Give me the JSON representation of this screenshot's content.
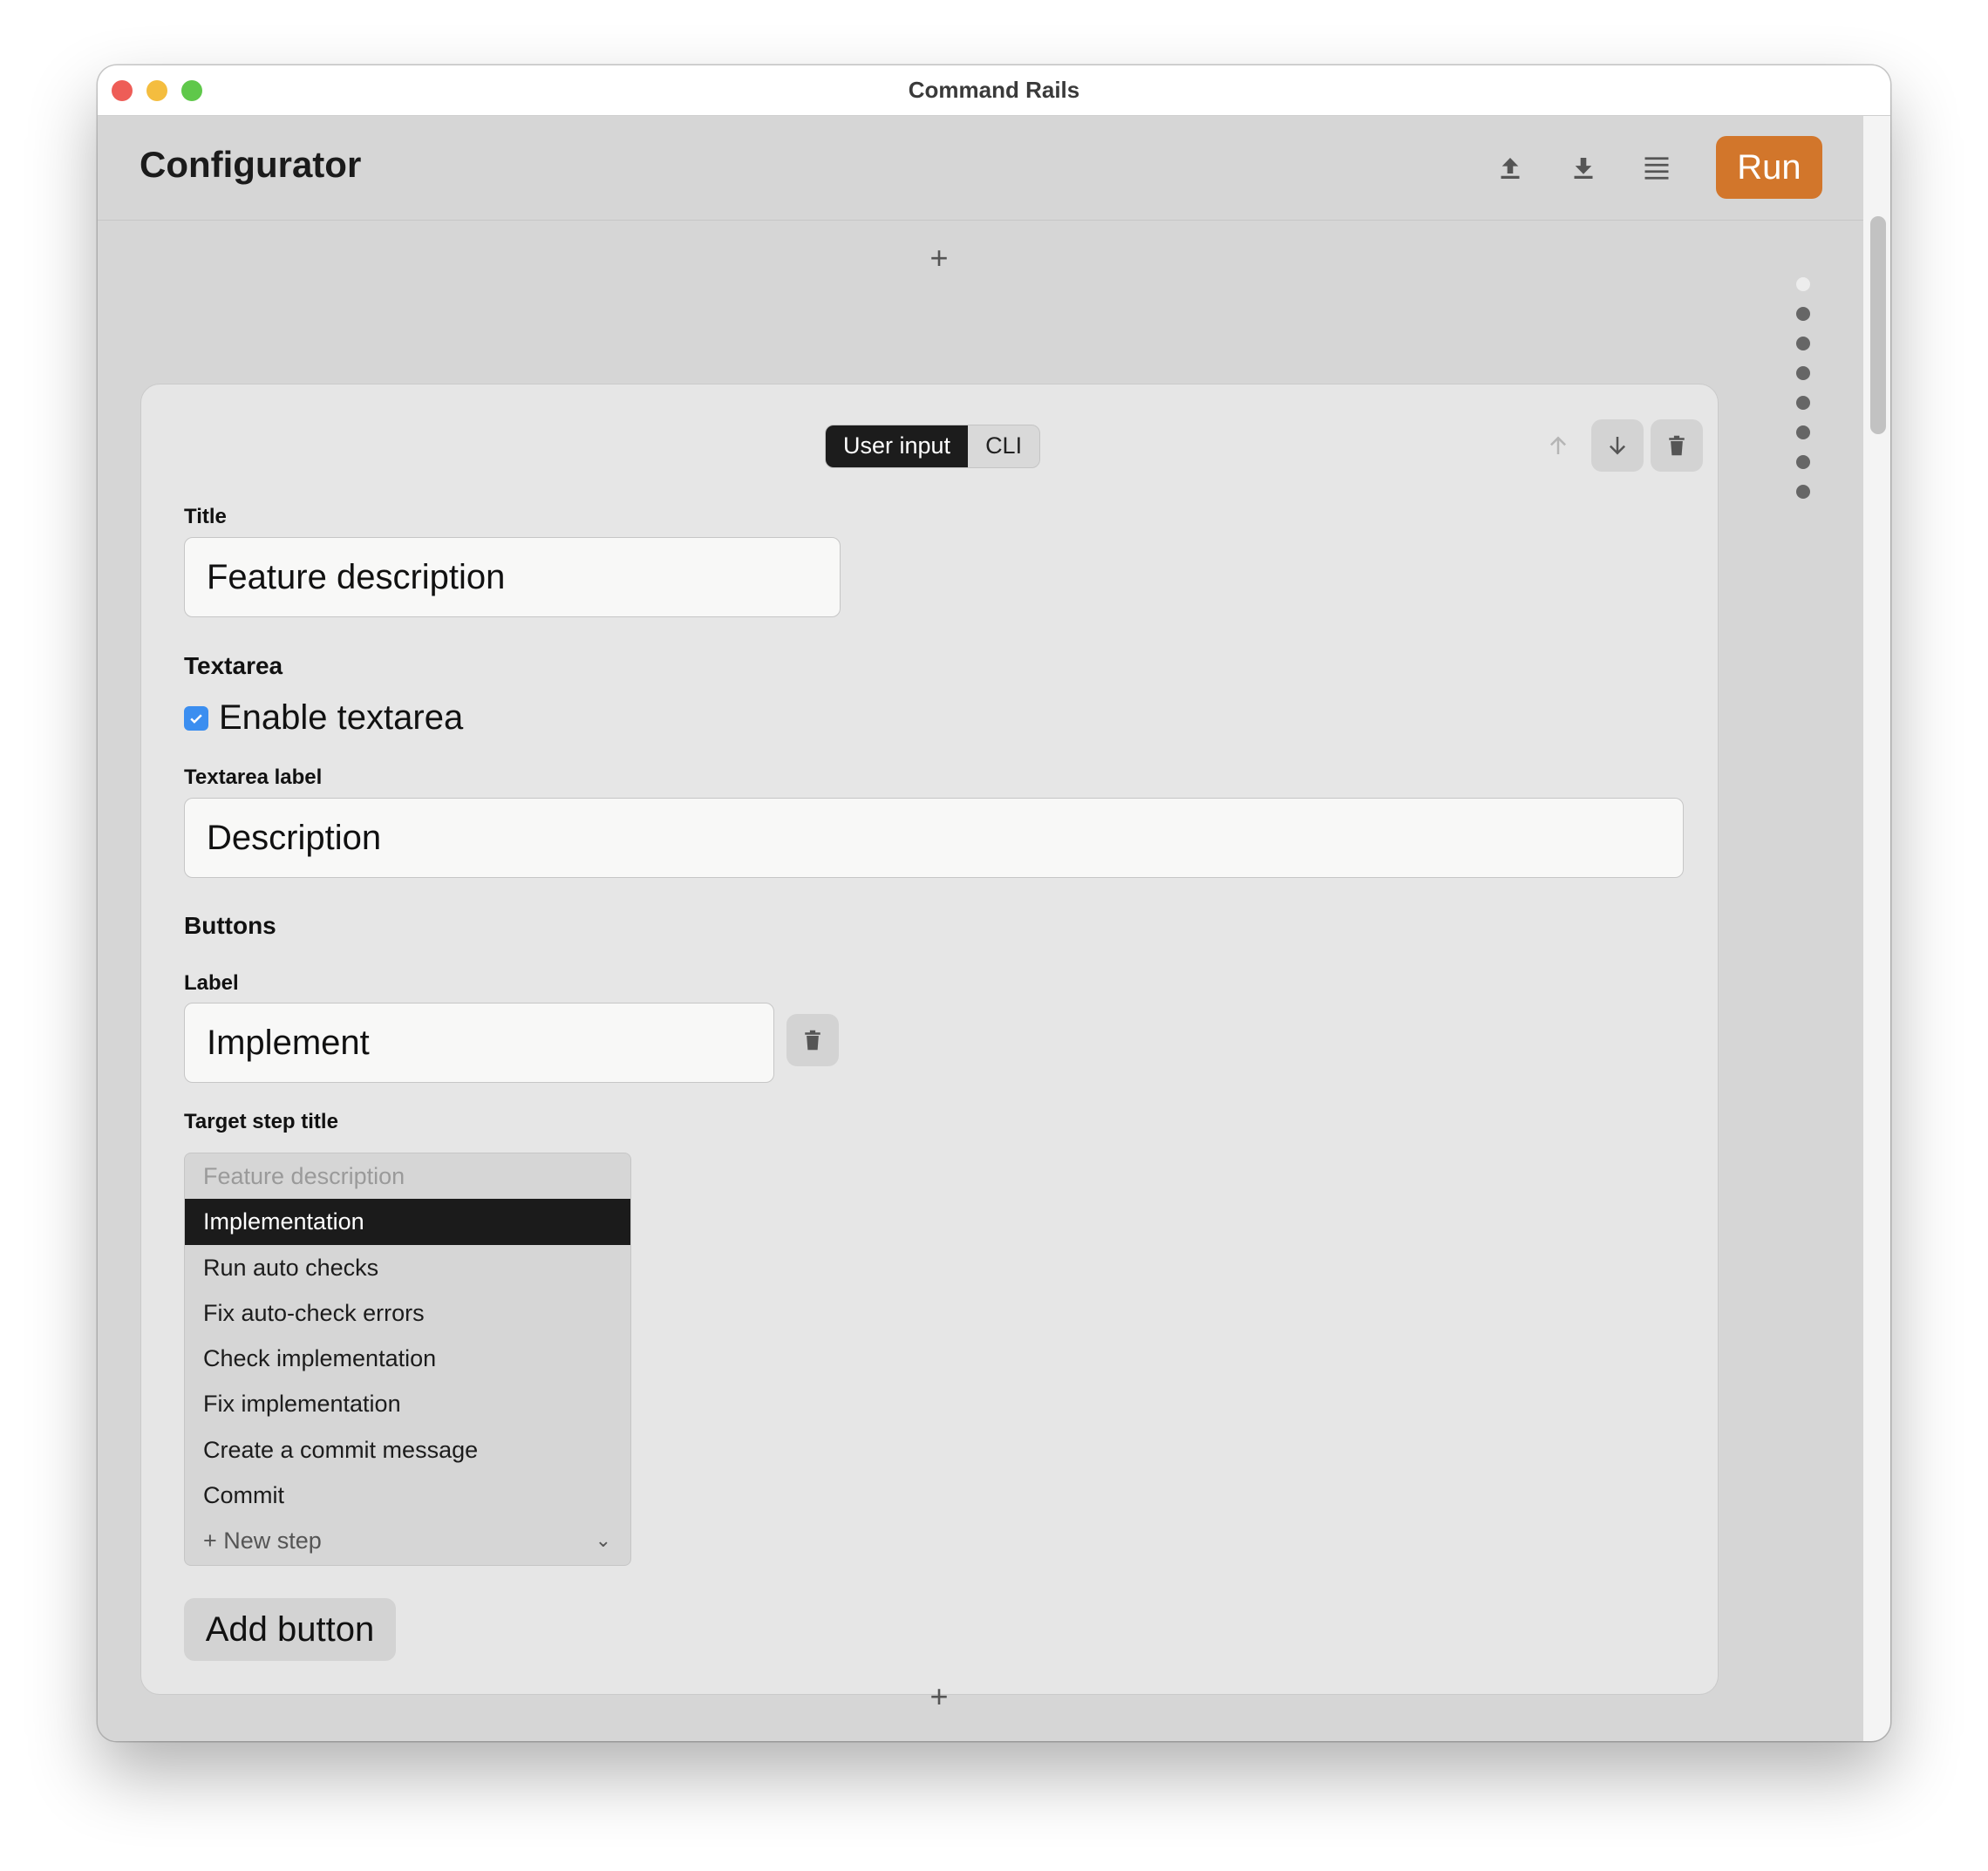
{
  "window": {
    "title": "Command Rails"
  },
  "header": {
    "title": "Configurator",
    "icons": [
      "upload-icon",
      "download-icon",
      "list-icon"
    ],
    "run_label": "Run",
    "run_color": "#d2762b"
  },
  "add_step_symbol": "+",
  "card": {
    "mode_tabs": [
      {
        "label": "User input",
        "active": true
      },
      {
        "label": "CLI",
        "active": false
      }
    ],
    "title_label": "Title",
    "title_value": "Feature description",
    "textarea_section": "Textarea",
    "enable_textarea_label": "Enable textarea",
    "enable_textarea_checked": true,
    "textarea_label_label": "Textarea label",
    "textarea_label_value": "Description",
    "buttons_section": "Buttons",
    "button_label_label": "Label",
    "button_label_value": "Implement",
    "target_step_label": "Target step title",
    "target_options": [
      "Feature description",
      "Implementation",
      "Run auto checks",
      "Fix auto-check errors",
      "Check implementation",
      "Fix implementation",
      "Create a commit message",
      "Commit",
      "+ New step"
    ],
    "target_selected": "Implementation",
    "add_button_label": "Add button"
  },
  "colors": {
    "accent": "#d2762b",
    "checkbox": "#3b8ef0",
    "selected_option_bg": "#1b1b1b"
  }
}
